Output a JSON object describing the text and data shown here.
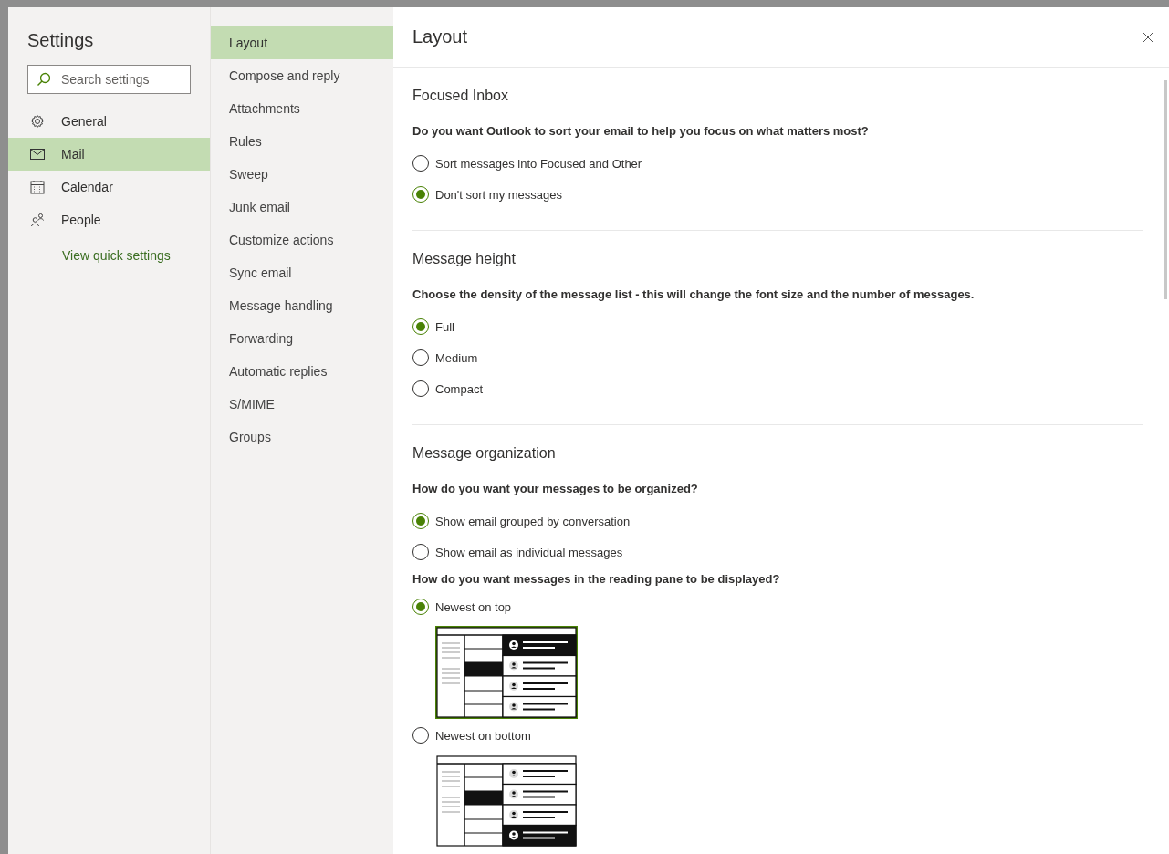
{
  "settings_pane": {
    "title": "Settings",
    "search": {
      "placeholder": "Search settings"
    },
    "items": [
      {
        "kind": "gear",
        "label": "General",
        "selected": false
      },
      {
        "kind": "mail",
        "label": "Mail",
        "selected": true
      },
      {
        "kind": "calendar",
        "label": "Calendar",
        "selected": false
      },
      {
        "kind": "people",
        "label": "People",
        "selected": false
      }
    ],
    "link": "View quick settings"
  },
  "mail_menu": {
    "items": [
      {
        "label": "Layout",
        "selected": true
      },
      {
        "label": "Compose and reply",
        "selected": false
      },
      {
        "label": "Attachments",
        "selected": false
      },
      {
        "label": "Rules",
        "selected": false
      },
      {
        "label": "Sweep",
        "selected": false
      },
      {
        "label": "Junk email",
        "selected": false
      },
      {
        "label": "Customize actions",
        "selected": false
      },
      {
        "label": "Sync email",
        "selected": false
      },
      {
        "label": "Message handling",
        "selected": false
      },
      {
        "label": "Forwarding",
        "selected": false
      },
      {
        "label": "Automatic replies",
        "selected": false
      },
      {
        "label": "S/MIME",
        "selected": false
      },
      {
        "label": "Groups",
        "selected": false
      }
    ]
  },
  "content": {
    "title": "Layout",
    "sections": [
      {
        "heading": "Focused Inbox",
        "groups": [
          {
            "question": "Do you want Outlook to sort your email to help you focus on what matters most?",
            "options": [
              {
                "label": "Sort messages into Focused and Other",
                "selected": false
              },
              {
                "label": "Don't sort my messages",
                "selected": true
              }
            ]
          }
        ]
      },
      {
        "heading": "Message height",
        "groups": [
          {
            "question": "Choose the density of the message list - this will change the font size and the number of messages.",
            "options": [
              {
                "label": "Full",
                "selected": true
              },
              {
                "label": "Medium",
                "selected": false
              },
              {
                "label": "Compact",
                "selected": false
              }
            ]
          }
        ]
      },
      {
        "heading": "Message organization",
        "groups": [
          {
            "question": "How do you want your messages to be organized?",
            "options": [
              {
                "label": "Show email grouped by conversation",
                "selected": true
              },
              {
                "label": "Show email as individual messages",
                "selected": false
              }
            ]
          },
          {
            "kind": "preview",
            "question": "How do you want messages in the reading pane to be displayed?",
            "options": [
              {
                "label": "Newest on top",
                "selected": true
              },
              {
                "label": "Newest on bottom",
                "selected": false
              }
            ]
          }
        ]
      }
    ]
  }
}
